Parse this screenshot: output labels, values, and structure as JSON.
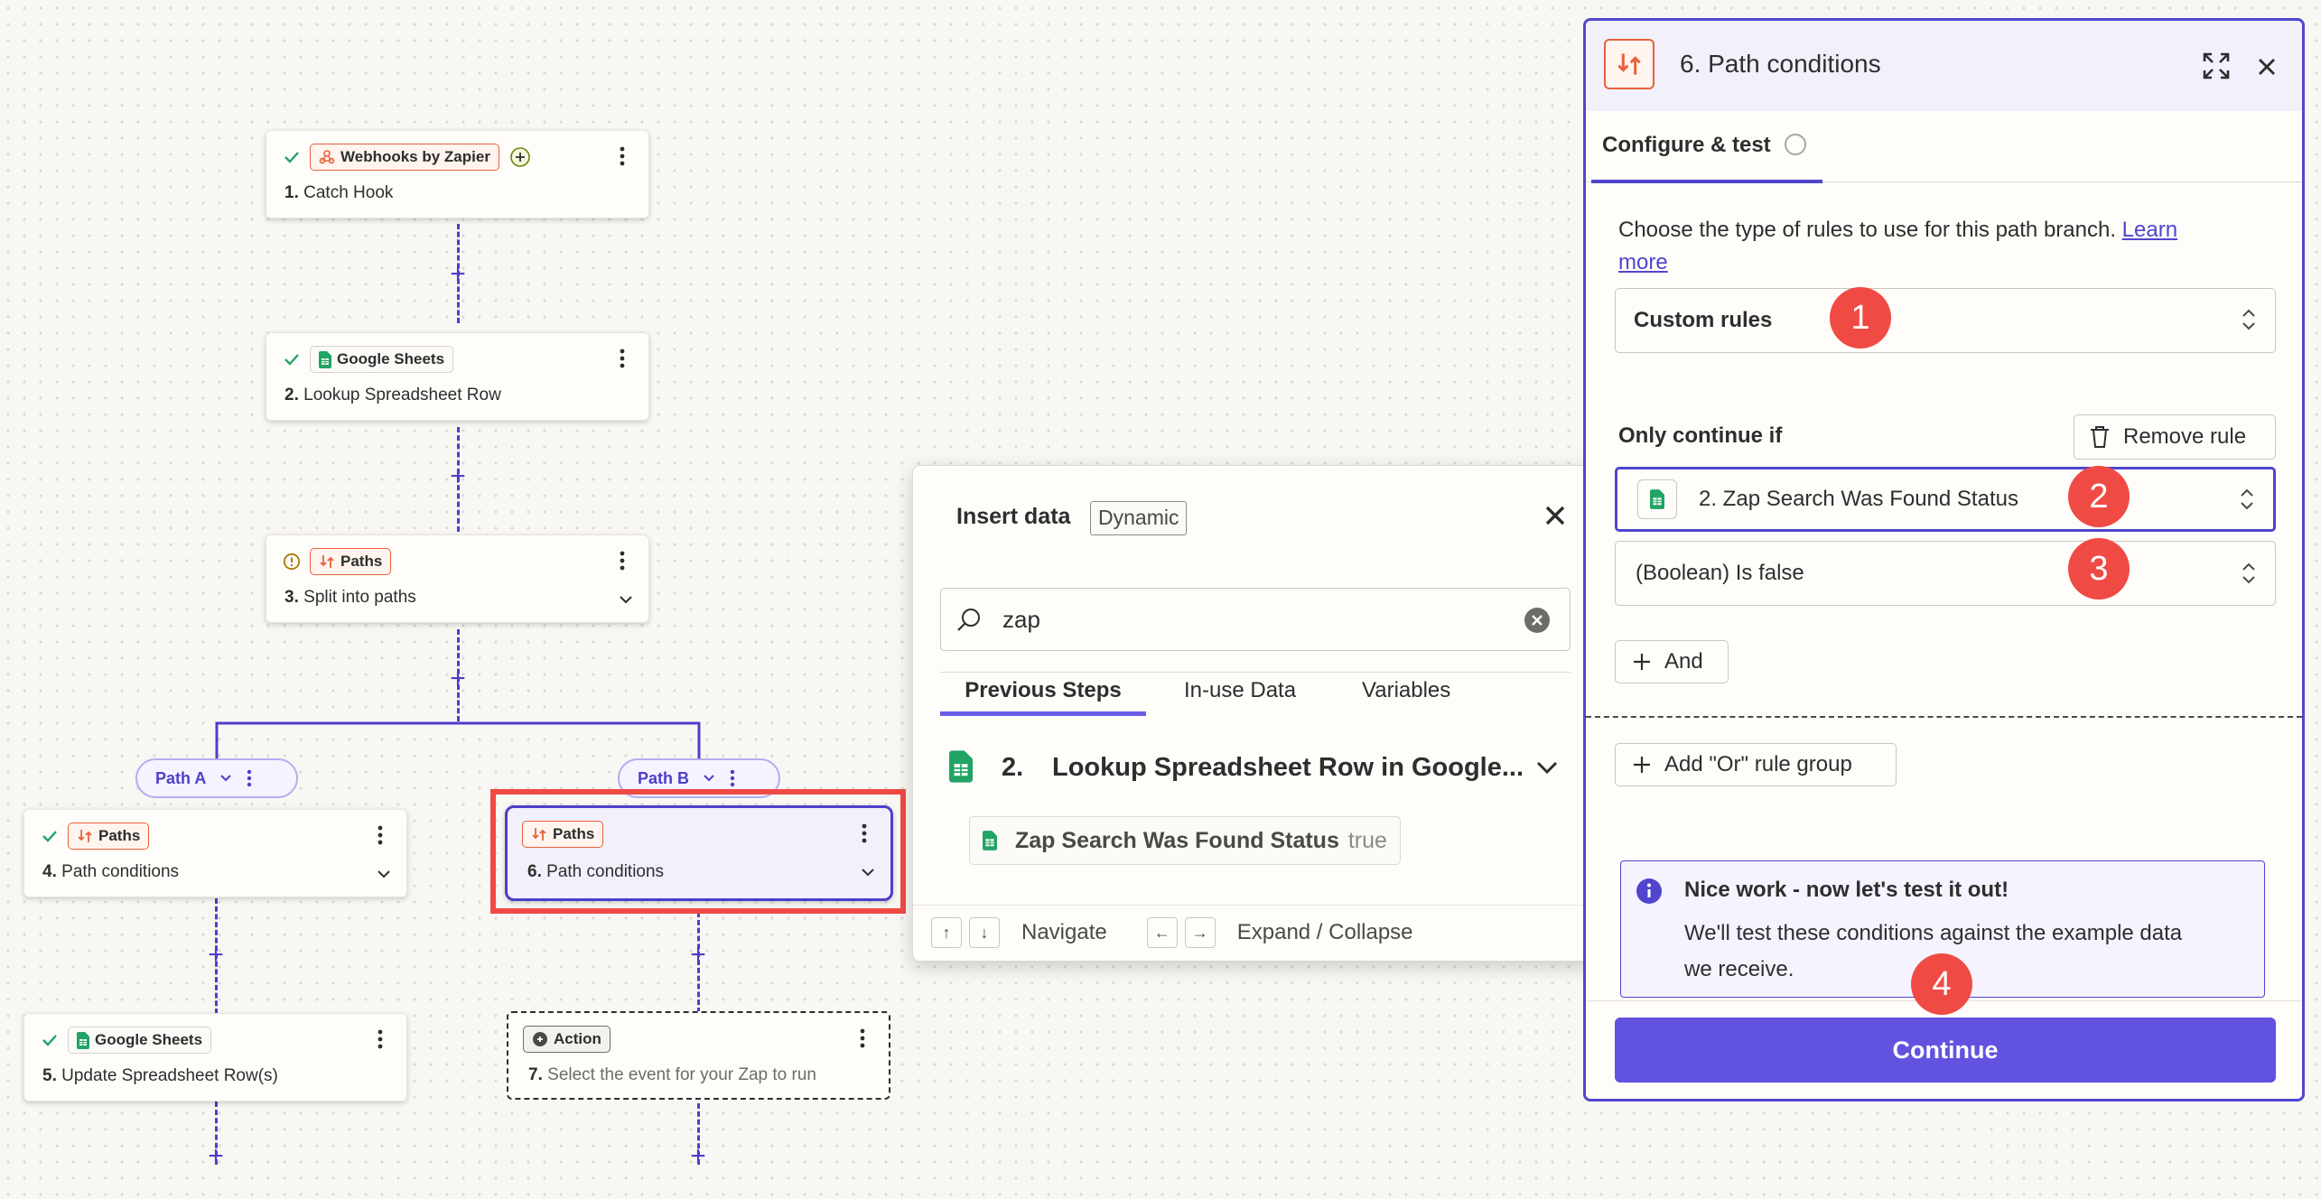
{
  "nodes": {
    "n1": {
      "app": "Webhooks by Zapier",
      "num": "1.",
      "label": "Catch Hook"
    },
    "n2": {
      "app": "Google Sheets",
      "num": "2.",
      "label": "Lookup Spreadsheet Row"
    },
    "n3": {
      "app": "Paths",
      "num": "3.",
      "label": "Split into paths"
    },
    "n4": {
      "app": "Paths",
      "num": "4.",
      "label": "Path conditions"
    },
    "n5": {
      "app": "Google Sheets",
      "num": "5.",
      "label": "Update Spreadsheet Row(s)"
    },
    "n6": {
      "app": "Paths",
      "num": "6.",
      "label": "Path conditions"
    },
    "n7": {
      "app": "Action",
      "num": "7.",
      "label": "Select the event for your Zap to run"
    }
  },
  "paths": {
    "a": "Path A",
    "b": "Path B"
  },
  "insert_data": {
    "title": "Insert data",
    "mode_badge": "Dynamic",
    "search_value": "zap",
    "tabs": [
      "Previous Steps",
      "In-use Data",
      "Variables"
    ],
    "active_tab": "Previous Steps",
    "step_num": "2.",
    "step_label": "Lookup Spreadsheet Row in Google...",
    "item_label": "Zap Search Was Found Status",
    "item_value": "true",
    "footer_navigate": "Navigate",
    "footer_expand": "Expand / Collapse",
    "key_up": "↑",
    "key_down": "↓",
    "key_left": "←",
    "key_right": "→"
  },
  "panel": {
    "title": "6. Path conditions",
    "tab": "Configure & test",
    "description": "Choose the type of rules to use for this path branch.",
    "learn_more_1": "Learn",
    "learn_more_2": "more",
    "rule_type": "Custom rules",
    "only_continue": "Only continue if",
    "remove_rule": "Remove rule",
    "field_value": "2. Zap Search Was Found Status",
    "condition_value": "(Boolean) Is false",
    "and_button": "And",
    "or_button": "Add \"Or\" rule group",
    "callout_title": "Nice work - now let's test it out!",
    "callout_body_1": "We'll test these conditions against the example data",
    "callout_body_2": "we receive.",
    "continue_button": "Continue"
  },
  "annotations": [
    "1",
    "2",
    "3",
    "4"
  ],
  "colors": {
    "accent": "#5145cd",
    "highlight_box": "#f04a45",
    "paths_orange": "#e8613c",
    "sheets_green": "#21a464"
  }
}
